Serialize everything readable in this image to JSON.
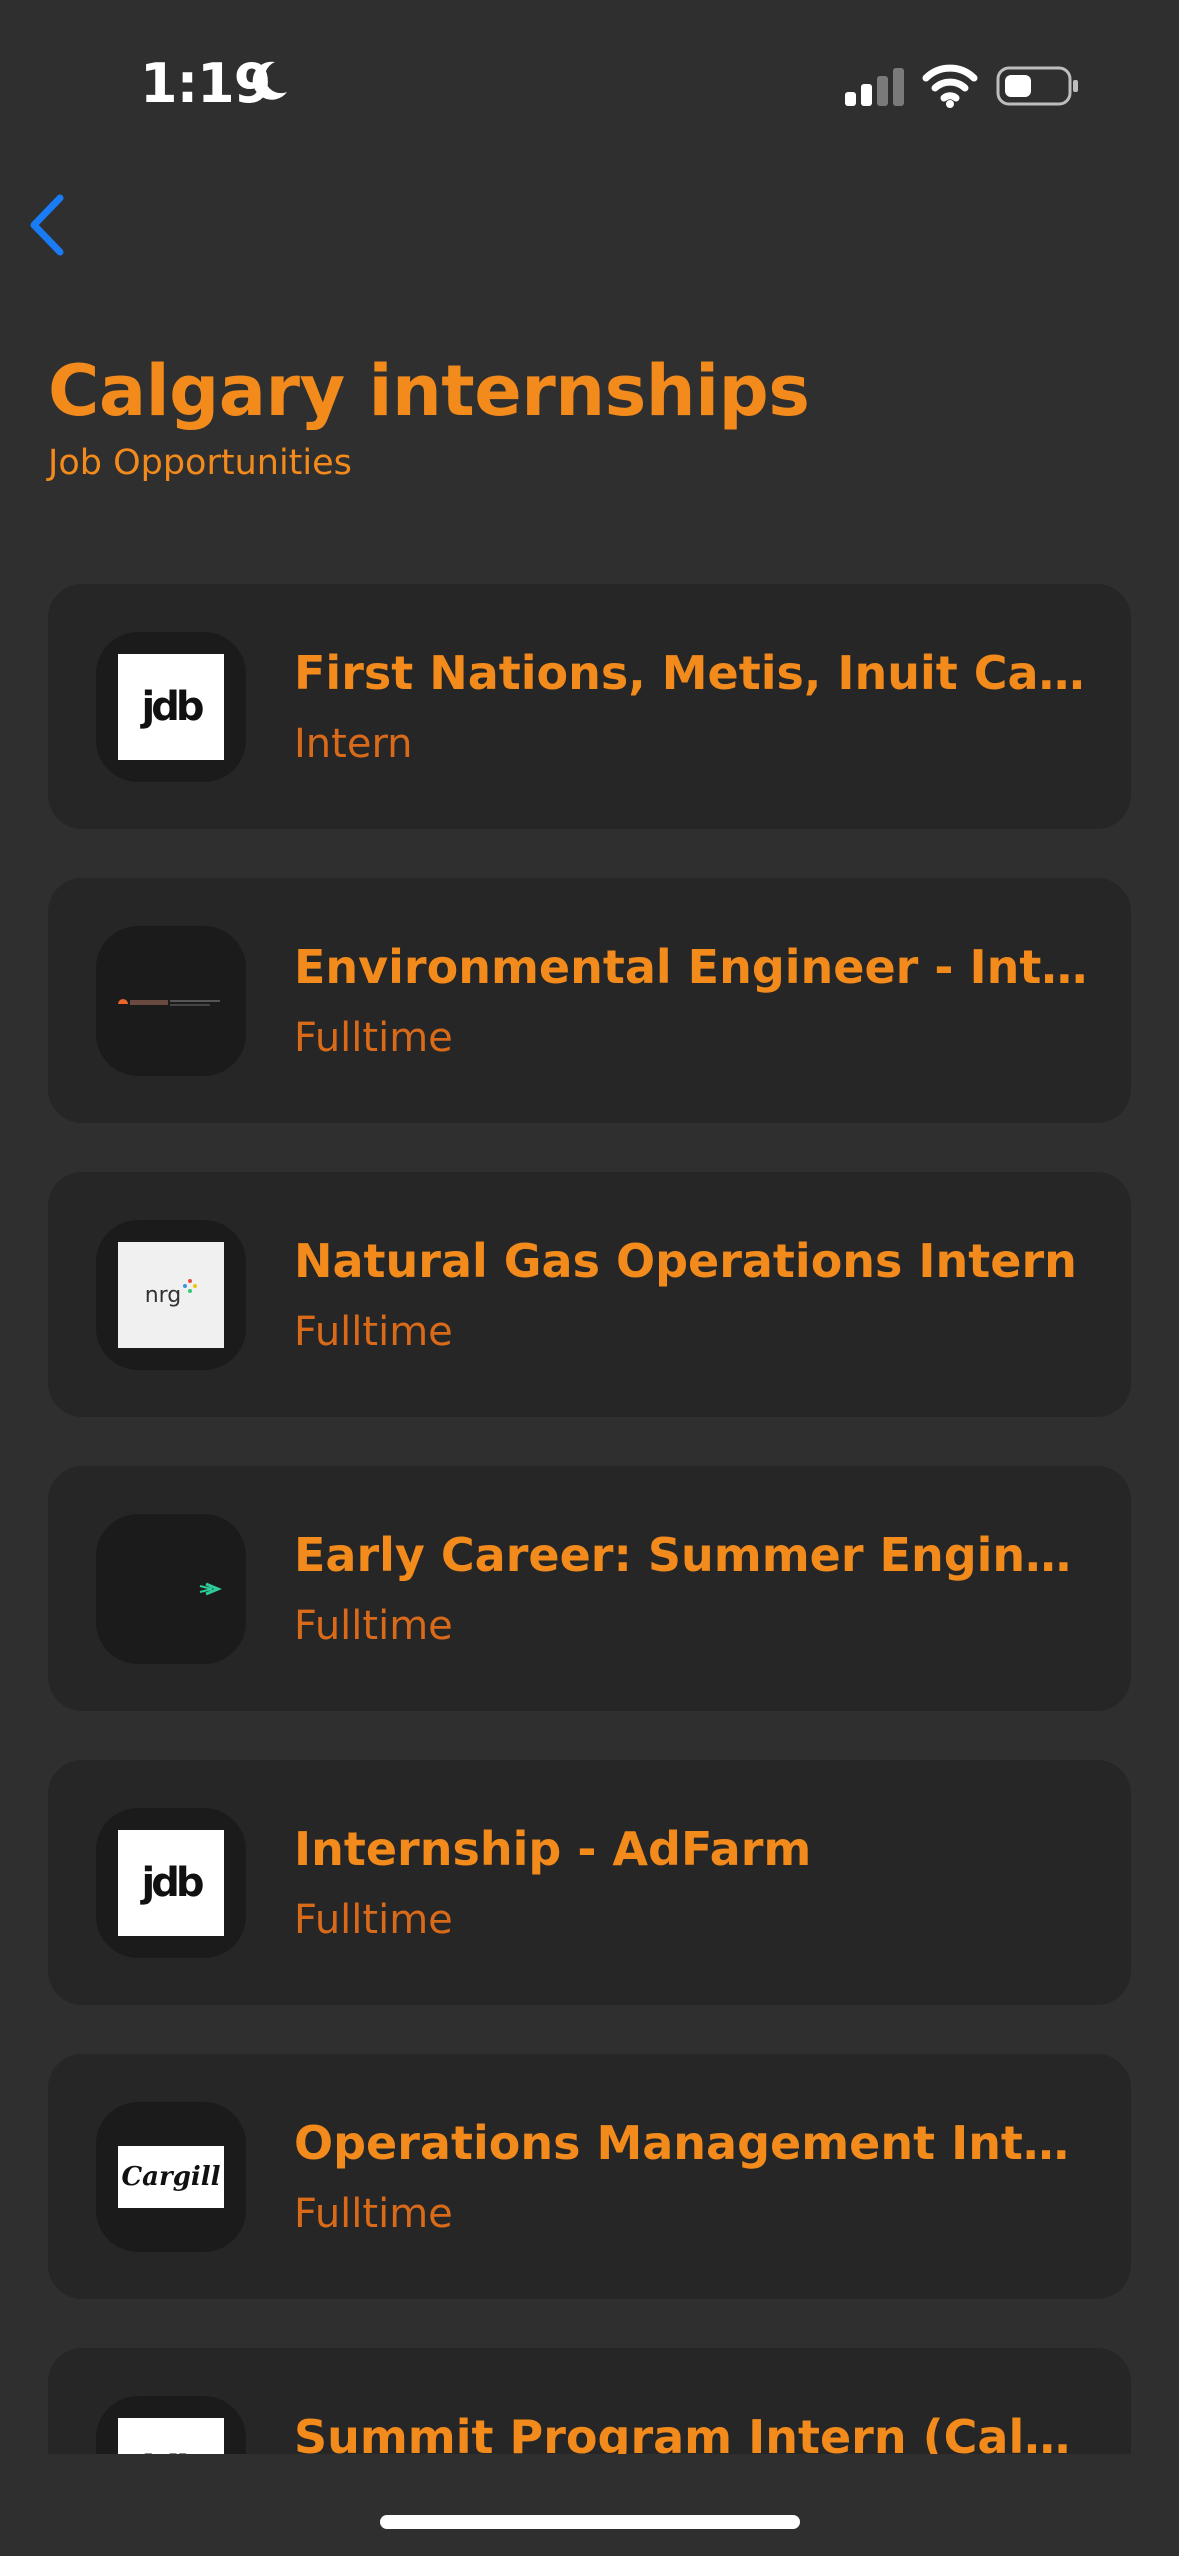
{
  "status_bar": {
    "time": "1:19"
  },
  "header": {
    "title": "Calgary internships",
    "subtitle": "Job Opportunities"
  },
  "jobs": [
    {
      "title": "First Nations, Metis, Inuit Cand...",
      "type": "Intern",
      "logo": "jdb"
    },
    {
      "title": "Environmental Engineer - Inter...",
      "type": "Fulltime",
      "logo": "arcadis"
    },
    {
      "title": "Natural Gas Operations Intern",
      "type": "Fulltime",
      "logo": "nrg"
    },
    {
      "title": "Early Career: Summer Enginee...",
      "type": "Fulltime",
      "logo": "green-arrow"
    },
    {
      "title": "Internship - AdFarm",
      "type": "Fulltime",
      "logo": "jdb"
    },
    {
      "title": "Operations Management Intern",
      "type": "Fulltime",
      "logo": "Cargill"
    },
    {
      "title": "Summit Program Intern (Calga...",
      "type": "",
      "logo": "jdb"
    }
  ],
  "logos": {
    "jdb_text": "jdb",
    "nrg_text": "nrg",
    "cargill_text": "Cargill"
  },
  "colors": {
    "background": "#2f2f2f",
    "card": "#262626",
    "accent": "#f28a1c",
    "back_arrow": "#1a7cf5"
  }
}
